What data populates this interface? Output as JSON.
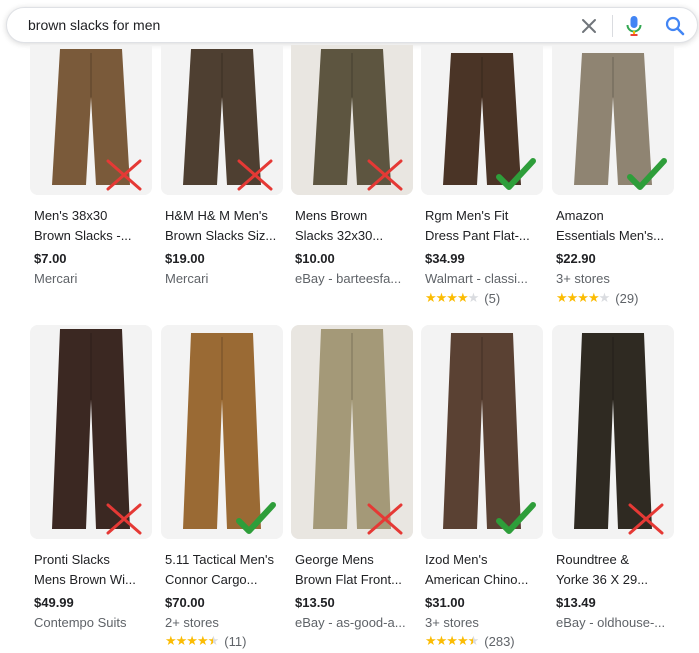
{
  "search": {
    "query": "brown slacks for men"
  },
  "icons": {
    "clear": "close-icon",
    "mic": "mic-icon",
    "search": "search-icon",
    "check": "check-mark-icon",
    "cross": "cross-mark-icon"
  },
  "colors": {
    "check": "#2e9e3a",
    "cross": "#e53935",
    "star": "#fbbc04",
    "link": "#4285f4"
  },
  "results": [
    {
      "title1": "Men's 38x30",
      "title2": "Brown Slacks -...",
      "price": "$7.00",
      "seller": "Mercari",
      "rating": "",
      "reviews": "",
      "mark": "cross",
      "fabric": "#7a5a3a"
    },
    {
      "title1": "H&M H& M Men's",
      "title2": "Brown Slacks Siz...",
      "price": "$19.00",
      "seller": "Mercari",
      "rating": "",
      "reviews": "",
      "mark": "cross",
      "fabric": "#4e3f31"
    },
    {
      "title1": "Mens Brown",
      "title2": "Slacks 32x30...",
      "price": "$10.00",
      "seller": "eBay - barteesfa...",
      "rating": "",
      "reviews": "",
      "mark": "cross",
      "fabric": "#5d5540"
    },
    {
      "title1": "Rgm Men's Fit",
      "title2": "Dress Pant Flat-...",
      "price": "$34.99",
      "seller": "Walmart - classi...",
      "rating": 4,
      "reviews": "(5)",
      "mark": "check",
      "fabric": "#4a3426"
    },
    {
      "title1": "Amazon",
      "title2": "Essentials Men's...",
      "price": "$22.90",
      "seller": "3+ stores",
      "rating": 4,
      "reviews": "(29)",
      "mark": "check",
      "fabric": "#8f8472"
    },
    {
      "title1": "Pronti Slacks",
      "title2": "Mens Brown Wi...",
      "price": "$49.99",
      "seller": "Contempo Suits",
      "rating": "",
      "reviews": "",
      "mark": "cross",
      "fabric": "#3b2822"
    },
    {
      "title1": "5.11 Tactical Men's",
      "title2": "Connor Cargo...",
      "price": "$70.00",
      "seller": "2+ stores",
      "rating": 4.5,
      "reviews": "(11)",
      "mark": "check",
      "fabric": "#9a6a34"
    },
    {
      "title1": "George Mens",
      "title2": "Brown Flat Front...",
      "price": "$13.50",
      "seller": "eBay - as-good-a...",
      "rating": "",
      "reviews": "",
      "mark": "cross",
      "fabric": "#a49978"
    },
    {
      "title1": "Izod Men's",
      "title2": "American Chino...",
      "price": "$31.00",
      "seller": "3+ stores",
      "rating": 4.5,
      "reviews": "(283)",
      "mark": "check",
      "fabric": "#5a4133"
    },
    {
      "title1": "Roundtree &",
      "title2": "Yorke 36 X 29...",
      "price": "$13.49",
      "seller": "eBay - oldhouse-...",
      "rating": "",
      "reviews": "",
      "mark": "cross",
      "fabric": "#2f2a22"
    }
  ]
}
